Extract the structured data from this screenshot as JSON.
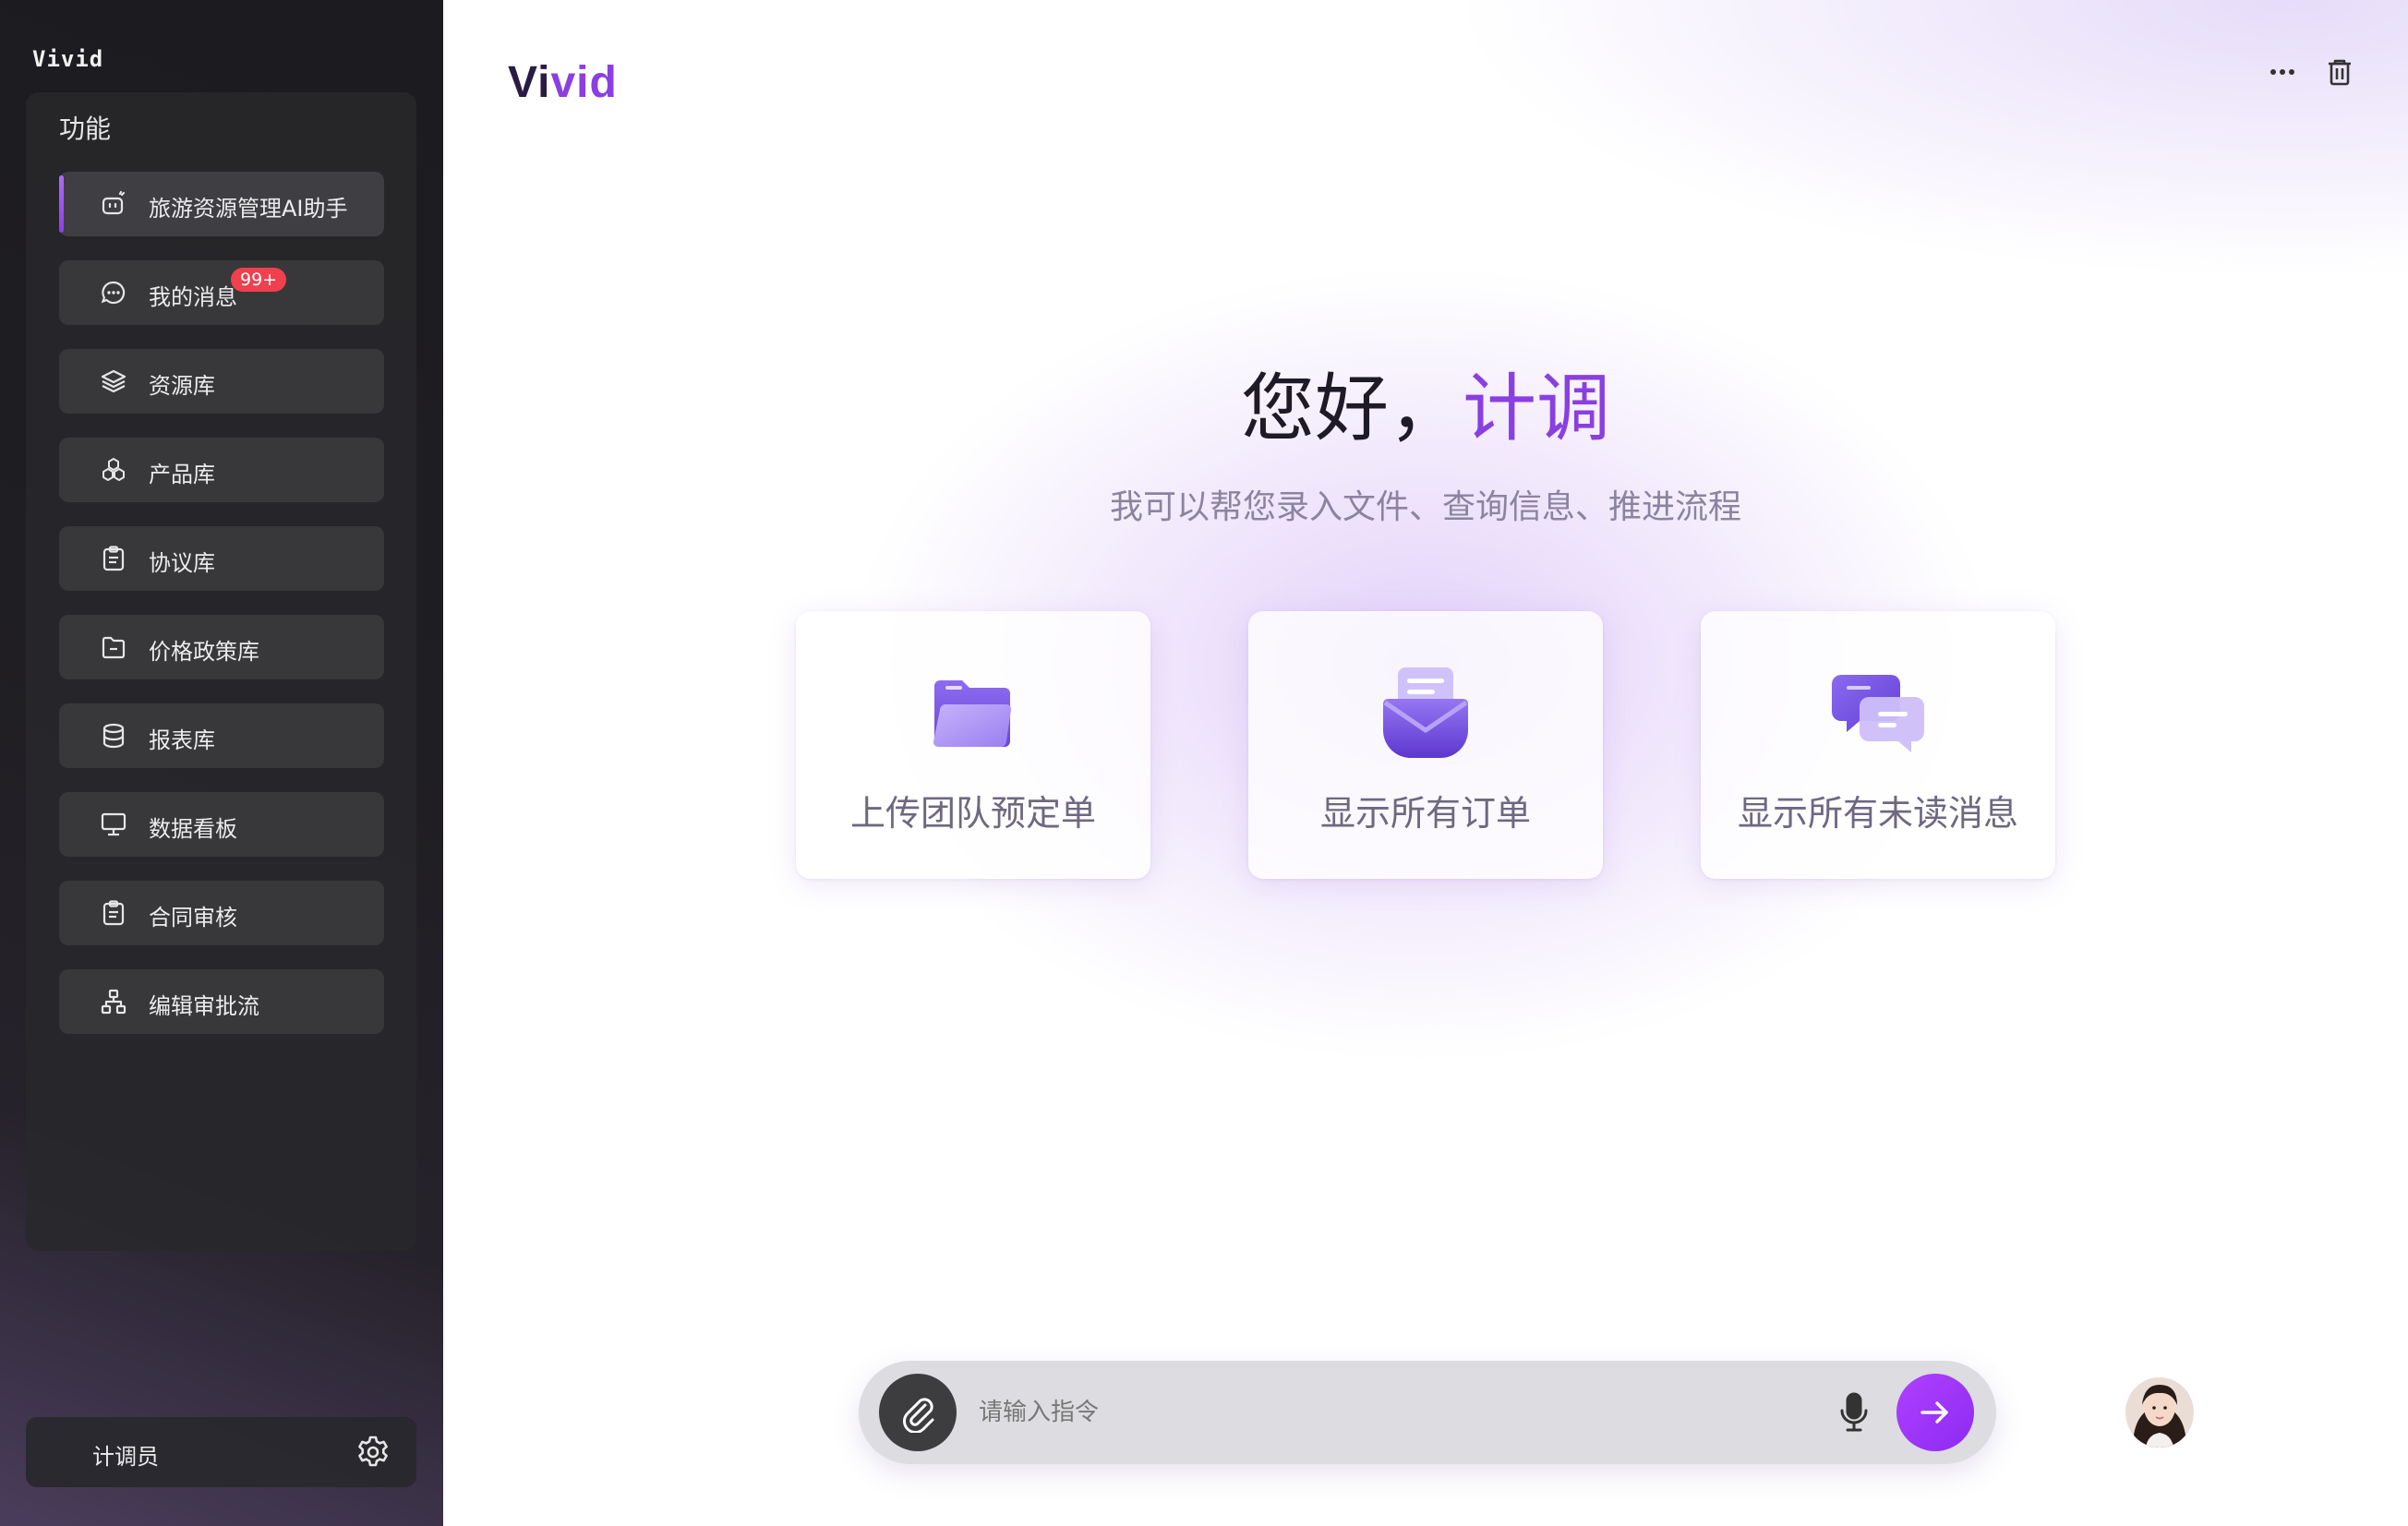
{
  "sidebar": {
    "brand": "Vivid",
    "menu_heading": "功能",
    "items": [
      {
        "label": "旅游资源管理AI助手",
        "icon": "robot-icon",
        "active": true
      },
      {
        "label": "我的消息",
        "icon": "chat-bubble-icon",
        "badge": "99+"
      },
      {
        "label": "资源库",
        "icon": "layers-icon"
      },
      {
        "label": "产品库",
        "icon": "boxes-icon"
      },
      {
        "label": "协议库",
        "icon": "clipboard-icon"
      },
      {
        "label": "价格政策库",
        "icon": "folder-minus-icon"
      },
      {
        "label": "报表库",
        "icon": "database-icon"
      },
      {
        "label": "数据看板",
        "icon": "monitor-icon"
      },
      {
        "label": "合同审核",
        "icon": "clipboard-check-icon"
      },
      {
        "label": "编辑审批流",
        "icon": "org-chart-icon"
      }
    ],
    "user": {
      "name": "计调员",
      "settings_icon": "gear-icon"
    }
  },
  "header": {
    "logo_part1": "Vi",
    "logo_part2": "vid",
    "more_icon": "more-dots-icon",
    "delete_icon": "trash-icon"
  },
  "hero": {
    "greeting": "您好，",
    "role": "计调",
    "subtitle": "我可以帮您录入文件、查询信息、推进流程"
  },
  "cards": [
    {
      "label": "上传团队预定单",
      "icon": "folder-icon"
    },
    {
      "label": "显示所有订单",
      "icon": "envelope-icon"
    },
    {
      "label": "显示所有未读消息",
      "icon": "messages-icon"
    }
  ],
  "composer": {
    "placeholder": "请输入指令",
    "attach_icon": "paperclip-icon",
    "mic_icon": "microphone-icon",
    "send_icon": "arrow-right-icon"
  },
  "colors": {
    "accent": "#8a3fe0",
    "sidebar_bg": "#1f1e22",
    "badge": "#f0404d",
    "send_button": "#9b33f8"
  }
}
